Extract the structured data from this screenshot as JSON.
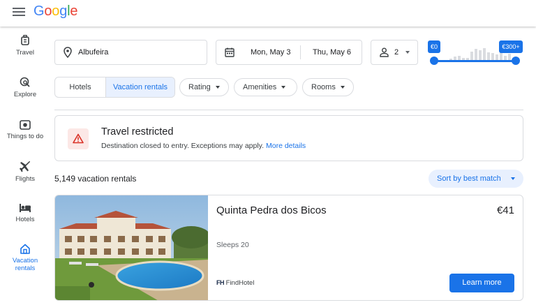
{
  "brand": {
    "logo_letters": [
      "G",
      "o",
      "o",
      "g",
      "l",
      "e"
    ]
  },
  "sidebar": {
    "items": [
      {
        "label": "Travel",
        "icon": "luggage-icon",
        "active": false
      },
      {
        "label": "Explore",
        "icon": "explore-search-icon",
        "active": false
      },
      {
        "label": "Things to do",
        "icon": "camera-icon",
        "active": false
      },
      {
        "label": "Flights",
        "icon": "airplane-icon",
        "active": false
      },
      {
        "label": "Hotels",
        "icon": "bed-icon",
        "active": false
      },
      {
        "label": "Vacation rentals",
        "label_line1": "Vacation",
        "label_line2": "rentals",
        "icon": "house-icon",
        "active": true
      }
    ]
  },
  "search": {
    "location": "Albufeira",
    "check_in": "Mon, May 3",
    "check_out": "Thu, May 6",
    "guests": "2",
    "price_min": "€0",
    "price_max": "€300+"
  },
  "filters": {
    "segments": [
      {
        "label": "Hotels",
        "selected": false
      },
      {
        "label": "Vacation rentals",
        "selected": true
      }
    ],
    "chips": [
      "Rating",
      "Amenities",
      "Rooms"
    ]
  },
  "alert": {
    "title": "Travel restricted",
    "body": "Destination closed to entry. Exceptions may apply.",
    "link": "More details"
  },
  "results": {
    "count_text": "5,149 vacation rentals",
    "sort_label": "Sort by best match"
  },
  "listing": {
    "title": "Quinta Pedra dos Bicos",
    "price": "€41",
    "sleeps": "Sleeps 20",
    "provider_logo": "FH",
    "provider_name": "FindHotel",
    "button": "Learn more"
  },
  "colors": {
    "accent": "#1a73e8",
    "alert_bg": "#fce8e6",
    "alert_icon": "#d93025"
  }
}
